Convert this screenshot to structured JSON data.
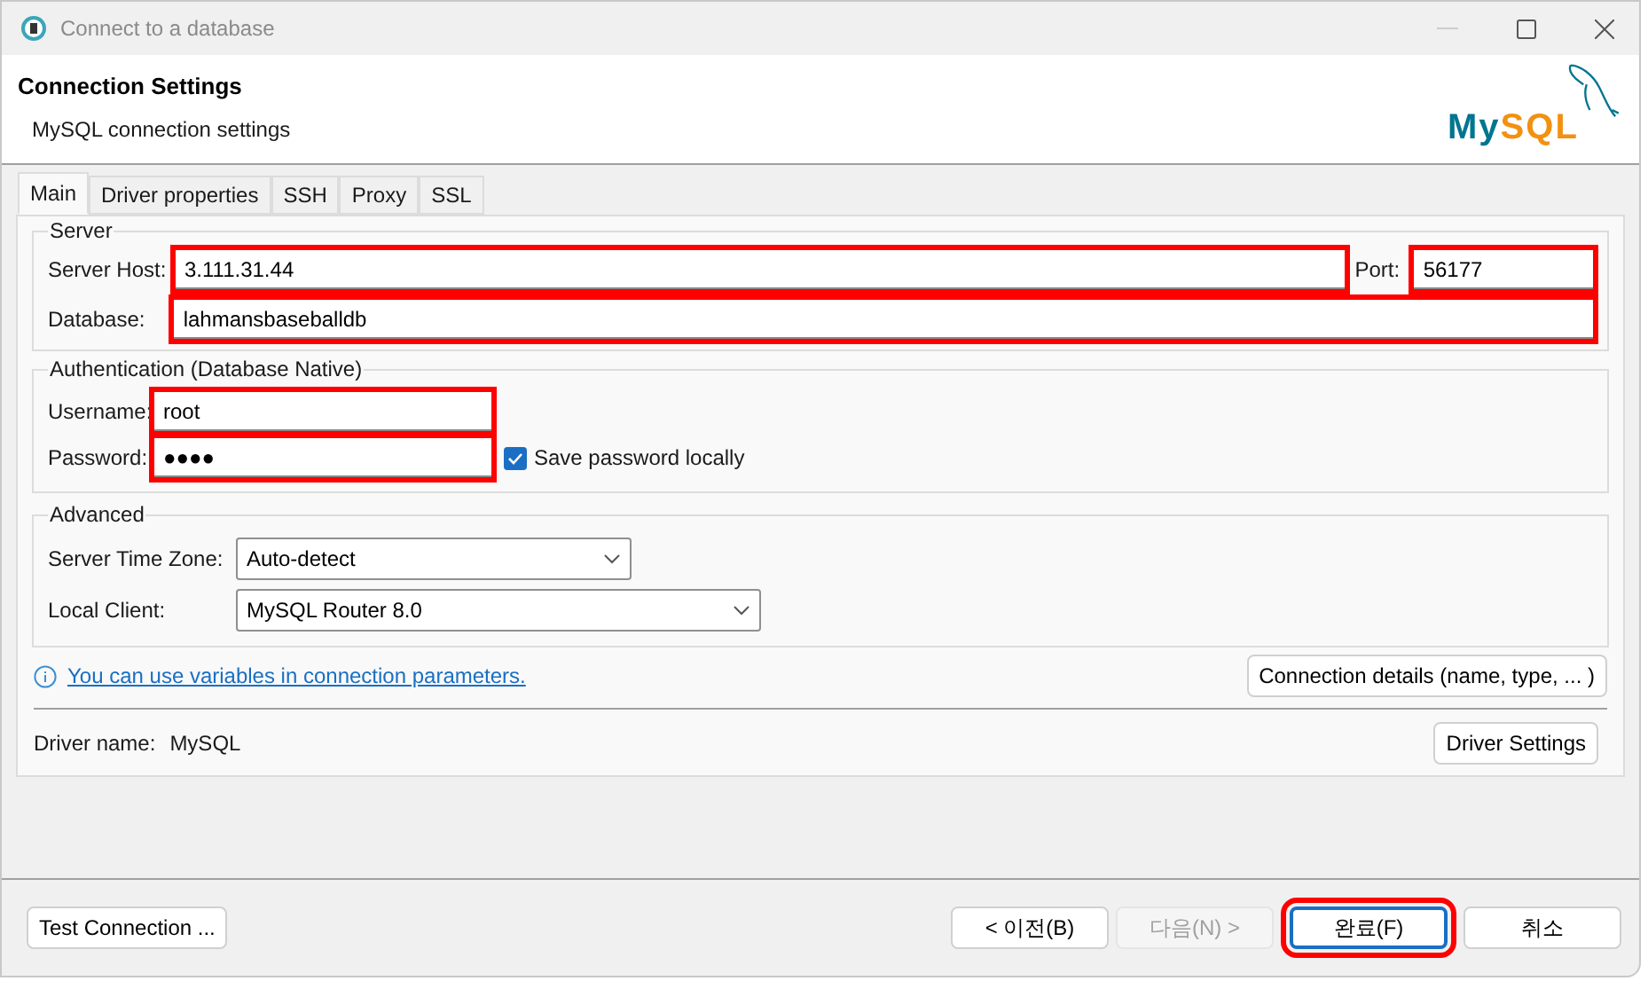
{
  "window": {
    "title": "Connect to a database"
  },
  "header": {
    "title": "Connection Settings",
    "subtitle": "MySQL connection settings",
    "logo": [
      {
        "text": "My",
        "color": "#00758f"
      },
      {
        "text": "SQL",
        "color": "#f29111"
      }
    ]
  },
  "tabs": [
    {
      "label": "Main",
      "selected": true
    },
    {
      "label": "Driver properties",
      "selected": false
    },
    {
      "label": "SSH",
      "selected": false
    },
    {
      "label": "Proxy",
      "selected": false
    },
    {
      "label": "SSL",
      "selected": false
    }
  ],
  "server": {
    "legend": "Server",
    "host": {
      "label": "Server Host:",
      "value": "3.111.31.44",
      "highlighted": true
    },
    "port": {
      "label": "Port:",
      "value": "56177",
      "highlighted": true
    },
    "database": {
      "label": "Database:",
      "value": "lahmansbaseballdb",
      "highlighted": true
    }
  },
  "authentication": {
    "legend": "Authentication (Database Native)",
    "username": {
      "label": "Username:",
      "value": "root",
      "highlighted": true
    },
    "password": {
      "label": "Password:",
      "value": "●●●●",
      "highlighted": true
    },
    "save_password": {
      "label": "Save password locally",
      "checked": true
    }
  },
  "advanced": {
    "legend": "Advanced",
    "time_zone": {
      "label": "Server Time Zone:",
      "value": "Auto-detect"
    },
    "local_client": {
      "label": "Local Client:",
      "value": "MySQL Router 8.0"
    }
  },
  "info_link": "You can use variables in connection parameters.",
  "connection_details_button": "Connection details (name, type, ... )",
  "driver": {
    "label": "Driver name:",
    "value": "MySQL",
    "button": "Driver Settings"
  },
  "footer": {
    "test_button": "Test Connection ...",
    "buttons": [
      {
        "label": "< 이전(B)",
        "disabled": false,
        "default": false,
        "highlighted": false
      },
      {
        "label": "다음(N) >",
        "disabled": true,
        "default": false,
        "highlighted": false
      },
      {
        "label": "완료(F)",
        "disabled": false,
        "default": true,
        "highlighted": true
      },
      {
        "label": "취소",
        "disabled": false,
        "default": false,
        "highlighted": false
      }
    ]
  }
}
